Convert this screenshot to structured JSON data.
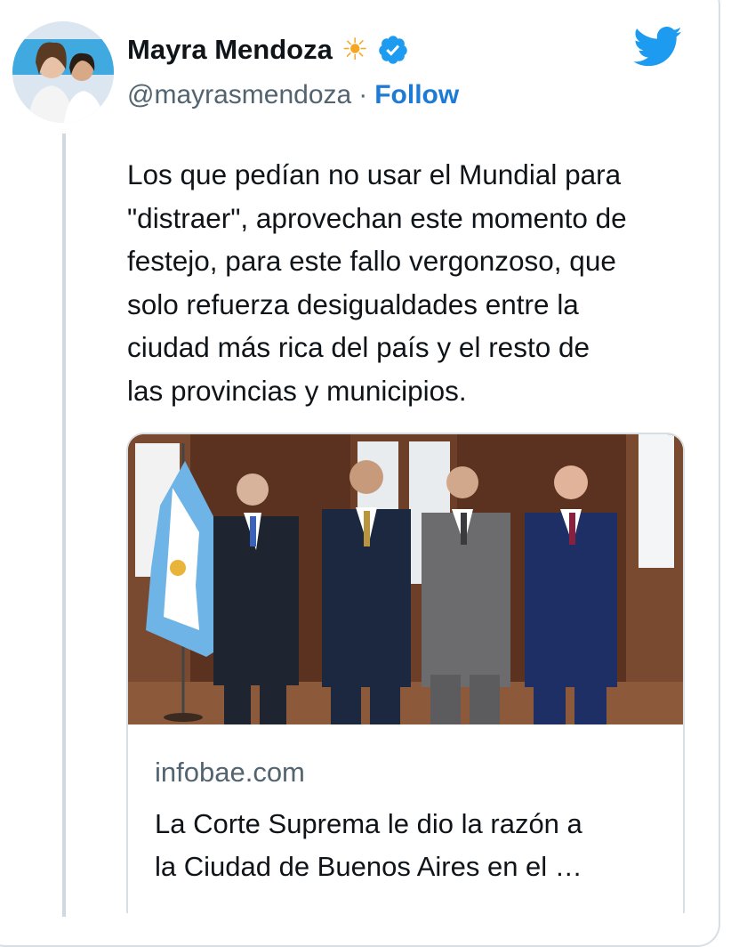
{
  "tweet": {
    "author_name": "Mayra Mendoza",
    "author_emoji": "☀",
    "handle": "@mayrasmendoza",
    "separator": "·",
    "follow_label": "Follow",
    "text": "Los que pedían no usar el Mundial para\n\"distraer\", aprovechan este momento de\nfestejo, para este fallo vergonzoso, que\nsolo refuerza desigualdades entre la\nciudad más rica del país y el resto de\nlas provincias y municipios."
  },
  "link_card": {
    "domain": "infobae.com",
    "title_line1": "La Corte Suprema le dio la razón a",
    "title_line2": "la Ciudad de Buenos Aires en el …"
  },
  "icons": {
    "bird": "twitter-bird-icon",
    "verified": "verified-badge-icon",
    "sun": "sun-emoji-icon"
  },
  "colors": {
    "accent": "#1d9bf0",
    "follow": "#1d7bd6",
    "text": "#0f1419",
    "muted": "#536471"
  }
}
